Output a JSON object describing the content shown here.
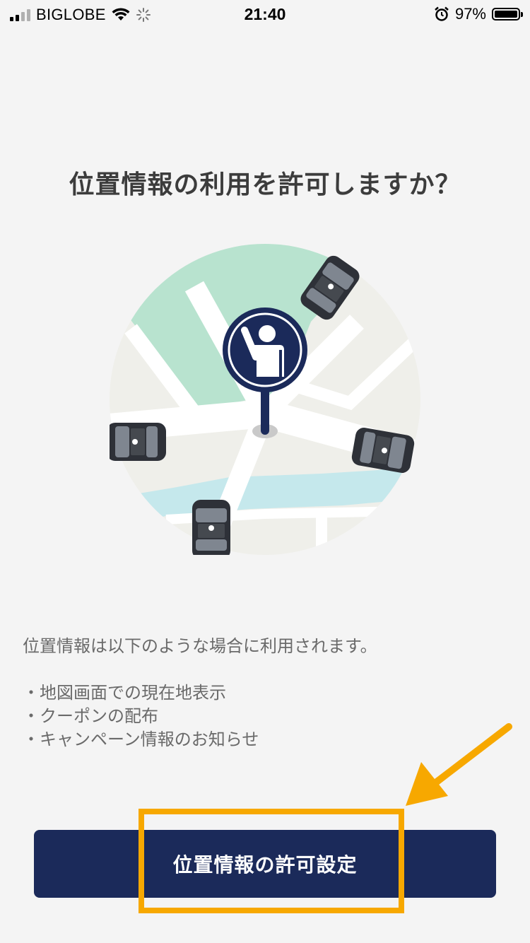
{
  "status_bar": {
    "carrier": "BIGLOBE",
    "time": "21:40",
    "battery_percent": "97%",
    "icons": [
      "signal-icon",
      "wifi-icon",
      "loading-spinner-icon",
      "alarm-icon",
      "battery-icon"
    ]
  },
  "main": {
    "title": "位置情報の利用を許可しますか？",
    "description": "位置情報は以下のような場合に利用されます。",
    "bullets": [
      "・地図画面での現在地表示",
      "・クーポンの配布",
      "・キャンペーン情報のお知らせ"
    ],
    "permit_button_label": "位置情報の許可設定"
  },
  "colors": {
    "background": "#f4f4f4",
    "button": "#1b2a5a",
    "highlight": "#f7a800",
    "map_park": "#b8e3cf",
    "map_water": "#c5e8ec",
    "pin": "#1b2a5a"
  }
}
